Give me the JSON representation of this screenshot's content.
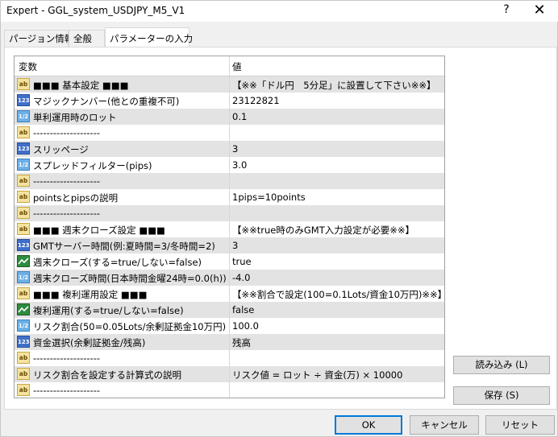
{
  "window": {
    "title": "Expert - GGL_system_USDJPY_M5_V1",
    "help": "?",
    "close": "✕"
  },
  "tabs": [
    {
      "label": "パージョン情報"
    },
    {
      "label": "全般"
    },
    {
      "label": "パラメーターの入力"
    }
  ],
  "grid": {
    "headers": {
      "name": "変数",
      "value": "値"
    },
    "rows": [
      {
        "icon": "ab",
        "name": "■■■ 基本設定 ■■■",
        "value": "【※※「ドル円　5分足」に設置して下さい※※】"
      },
      {
        "icon": "123",
        "name": "マジックナンバー(他との重複不可)",
        "value": "23122821"
      },
      {
        "icon": "1/2",
        "name": "単利運用時のロット",
        "value": "0.1"
      },
      {
        "icon": "ab",
        "name": "--------------------",
        "value": ""
      },
      {
        "icon": "123",
        "name": "スリッページ",
        "value": "3"
      },
      {
        "icon": "1/2",
        "name": "スプレッドフィルター(pips)",
        "value": "3.0"
      },
      {
        "icon": "ab",
        "name": "--------------------",
        "value": ""
      },
      {
        "icon": "ab",
        "name": "pointsとpipsの説明",
        "value": "1pips=10points"
      },
      {
        "icon": "ab",
        "name": "--------------------",
        "value": ""
      },
      {
        "icon": "ab",
        "name": "■■■ 週末クローズ設定 ■■■",
        "value": "【※※true時のみGMT入力設定が必要※※】"
      },
      {
        "icon": "123",
        "name": "GMTサーバー時間(例:夏時間=3/冬時間=2)",
        "value": "3"
      },
      {
        "icon": "bool",
        "name": "週末クローズ(する=true/しない=false)",
        "value": "true"
      },
      {
        "icon": "1/2",
        "name": "週末クローズ時間(日本時間金曜24時=0.0(h))",
        "value": "-4.0"
      },
      {
        "icon": "ab",
        "name": "■■■ 複利運用設定 ■■■",
        "value": "【※※割合で設定(100=0.1Lots/資金10万円)※※】"
      },
      {
        "icon": "bool",
        "name": "複利運用(する=true/しない=false)",
        "value": "false"
      },
      {
        "icon": "1/2",
        "name": "リスク割合(50=0.05Lots/余剰証拠金10万円)",
        "value": "100.0"
      },
      {
        "icon": "123",
        "name": "資金選択(余剰証拠金/残高)",
        "value": "残高"
      },
      {
        "icon": "ab",
        "name": "--------------------",
        "value": ""
      },
      {
        "icon": "ab",
        "name": "リスク割合を設定する計算式の説明",
        "value": "リスク値 = ロット ÷ 資金(万) × 10000"
      },
      {
        "icon": "ab",
        "name": "--------------------",
        "value": ""
      }
    ]
  },
  "buttons": {
    "load": "読み込み (L)",
    "save": "保存 (S)",
    "ok": "OK",
    "cancel": "キャンセル",
    "reset": "リセット"
  },
  "colors": {
    "accent": "#0078d7",
    "row_shade": "#e3e3e3"
  }
}
